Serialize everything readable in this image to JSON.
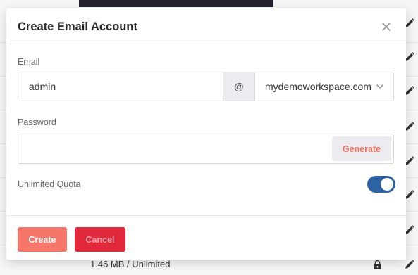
{
  "background": {
    "bottom_row_text": "1.46 MB / Unlimited",
    "icons": {
      "edit": "pencil-icon",
      "lock": "lock-icon"
    }
  },
  "modal": {
    "title": "Create Email Account",
    "close_icon": "close-icon",
    "email": {
      "label": "Email",
      "value": "admin",
      "at_symbol": "@",
      "domain": "mydemoworkspace.com",
      "domain_icon": "chevron-down-icon"
    },
    "password": {
      "label": "Password",
      "value": "",
      "generate_label": "Generate"
    },
    "quota": {
      "label": "Unlimited Quota",
      "enabled": true
    },
    "buttons": {
      "create": "Create",
      "cancel": "Cancel"
    }
  },
  "colors": {
    "toggle_on": "#2d63a4",
    "create_button": "#f6776a",
    "cancel_button": "#e2283b",
    "generate_text": "#f0705e"
  }
}
